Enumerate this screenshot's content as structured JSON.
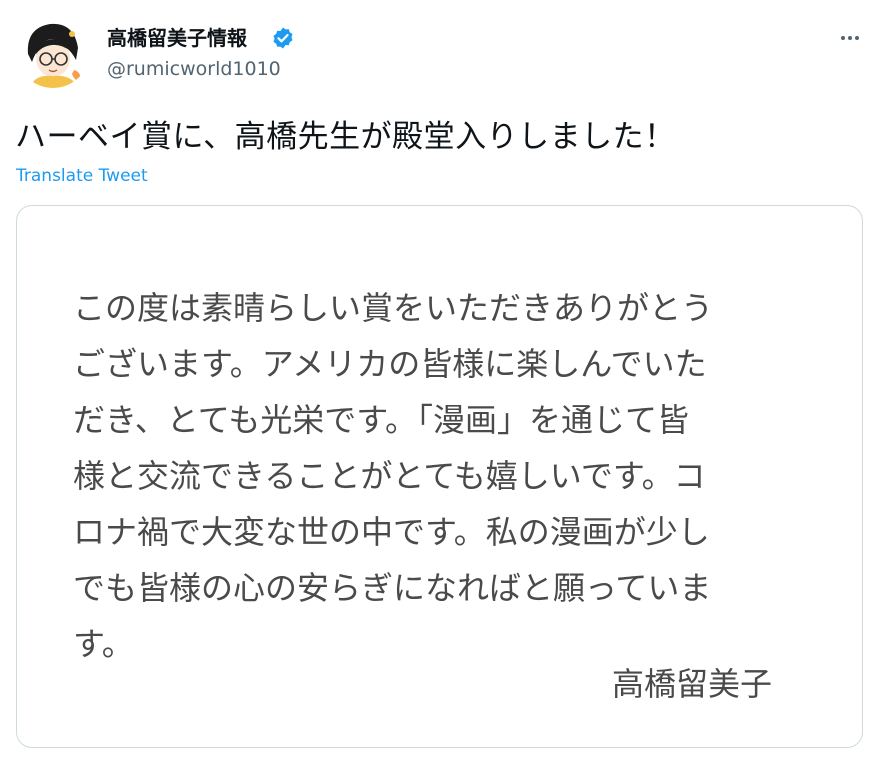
{
  "tweet": {
    "author": {
      "display_name": "高橋留美子情報",
      "handle": "@rumicworld1010",
      "verified_icon": "verified-badge-icon",
      "avatar_icon": "avatar-illustration"
    },
    "more_icon": "more-options-icon",
    "text": "ハーベイ賞に、高橋先生が殿堂入りしました！",
    "translate_label": "Translate Tweet",
    "media": {
      "statement_lines": [
        "この度は素晴らしい賞をいただきありがとう",
        "ございます。アメリカの皆様に楽しんでいた",
        "だき、とても光栄です。「漫画」を通じて皆",
        "様と交流できることがとても嬉しいです。コ",
        "ロナ禍で大変な世の中です。私の漫画が少し",
        "でも皆様の心の安らぎになればと願っていま",
        "す。"
      ],
      "signature": "高橋留美子"
    },
    "colors": {
      "accent": "#1d9bf0",
      "text_primary": "#0f1419",
      "text_secondary": "#536471",
      "border": "#cfd9de",
      "statement_text": "#4a4a4a"
    }
  }
}
